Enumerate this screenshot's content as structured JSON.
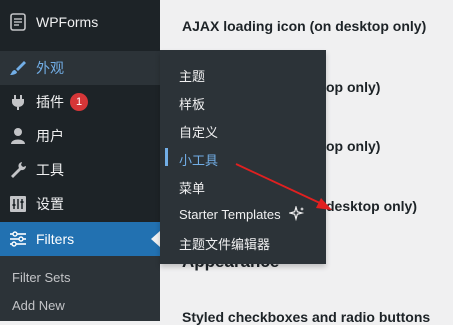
{
  "sidebar": {
    "app_title": "WPForms",
    "items": [
      {
        "label": "外观",
        "icon": "paintbrush-icon"
      },
      {
        "label": "插件",
        "icon": "plugin-icon",
        "badge": "1"
      },
      {
        "label": "用户",
        "icon": "user-icon"
      },
      {
        "label": "工具",
        "icon": "wrench-icon"
      },
      {
        "label": "设置",
        "icon": "settings-sliders-icon"
      },
      {
        "label": "Filters",
        "icon": "filters-icon"
      }
    ],
    "submenu": [
      "Filter Sets",
      "Add New"
    ]
  },
  "flyout": {
    "items": [
      "主题",
      "样板",
      "自定义",
      "小工具",
      "菜单",
      "Starter Templates",
      "主题文件编辑器"
    ],
    "current": "小工具"
  },
  "main": {
    "lines": [
      "AJAX loading icon (on desktop only)",
      "op only)",
      "op only)",
      "desktop only)"
    ],
    "heading": "Appearance",
    "footer_line": "Styled checkboxes and radio buttons"
  },
  "colors": {
    "sidebar_bg": "#1d2327",
    "active_bg": "#2271b1",
    "accent": "#72aee6",
    "badge": "#d63638",
    "arrow": "#e02020"
  }
}
